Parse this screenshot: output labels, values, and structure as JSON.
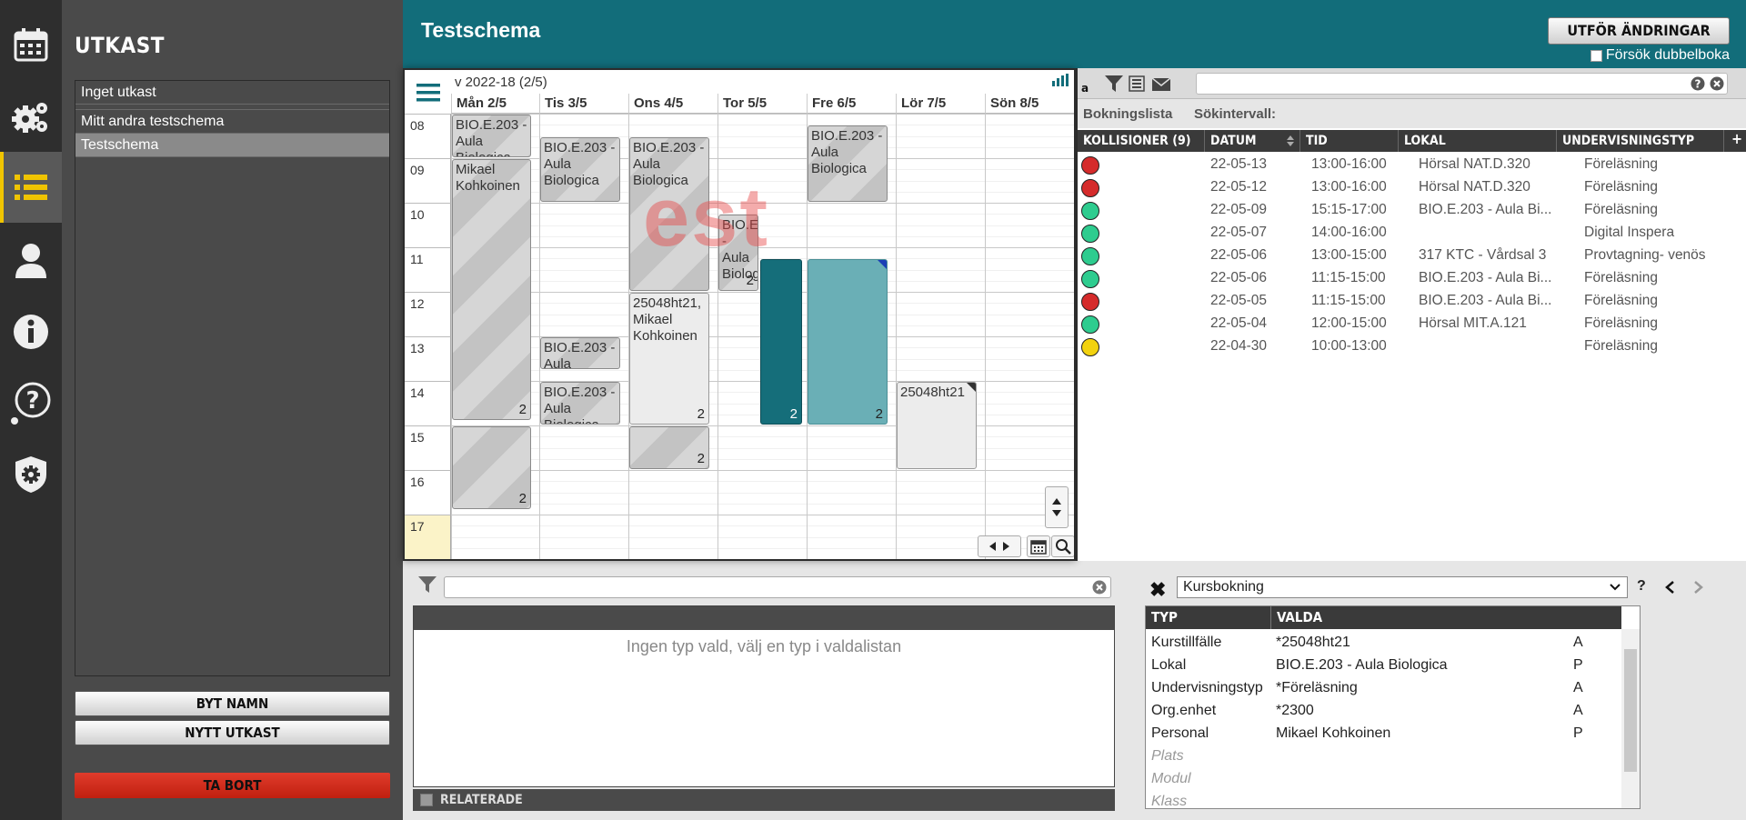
{
  "app": {
    "title": "Testschema",
    "apply_button": "UTFÖR ÄNDRINGAR",
    "double_booking_label": "Försök dubbelboka"
  },
  "nav_icons": [
    "calendar-icon",
    "settings-gears-icon",
    "list-icon",
    "user-icon",
    "info-icon",
    "help-icon",
    "admin-shield-icon"
  ],
  "drafts": {
    "heading": "UTKAST",
    "items": [
      {
        "label": "Inget utkast",
        "selected": false
      },
      {
        "label": "Mitt andra testschema",
        "selected": false
      },
      {
        "label": "Testschema",
        "selected": true
      }
    ],
    "rename_button": "BYT NAMN",
    "new_button": "NYTT UTKAST",
    "delete_button": "TA BORT"
  },
  "calendar": {
    "week_label": "v 2022-18 (2/5)",
    "days": [
      "Mån 2/5",
      "Tis 3/5",
      "Ons 4/5",
      "Tor 5/5",
      "Fre 6/5",
      "Lör 7/5",
      "Sön 8/5"
    ],
    "hours": [
      "08",
      "09",
      "10",
      "11",
      "12",
      "13",
      "14",
      "15",
      "16",
      "17"
    ],
    "current_hour": "17",
    "watermark": "est",
    "events": [
      {
        "day": 0,
        "start": 8.0,
        "end": 9.0,
        "text": "BIO.E.203 - Aula Biologica",
        "count": "",
        "style": "striped"
      },
      {
        "day": 0,
        "start": 9.0,
        "end": 14.9,
        "text": "Mikael Kohkoinen",
        "count": "2",
        "style": "striped"
      },
      {
        "day": 0,
        "start": 15.0,
        "end": 16.9,
        "text": "",
        "count": "2",
        "style": "striped"
      },
      {
        "day": 1,
        "start": 8.5,
        "end": 10.0,
        "text": "BIO.E.203 - Aula Biologica",
        "count": "",
        "style": "striped"
      },
      {
        "day": 1,
        "start": 13.0,
        "end": 13.75,
        "text": "BIO.E.203 - Aula Biologica",
        "count": "",
        "style": "striped"
      },
      {
        "day": 1,
        "start": 14.0,
        "end": 15.0,
        "text": "BIO.E.203 - Aula Biologica",
        "count": "",
        "style": "striped"
      },
      {
        "day": 2,
        "start": 8.5,
        "end": 12.0,
        "text": "BIO.E.203 - Aula Biologica",
        "count": "",
        "style": "striped"
      },
      {
        "day": 2,
        "start": 12.0,
        "end": 15.0,
        "text": "25048ht21, Mikael Kohkoinen",
        "count": "2",
        "style": "plain"
      },
      {
        "day": 2,
        "start": 15.0,
        "end": 16.0,
        "text": "",
        "count": "2",
        "style": "striped"
      },
      {
        "day": 3,
        "start": 10.25,
        "end": 12.0,
        "text": "BIO.E.203 - Aula Biologica",
        "count": "2",
        "style": "striped",
        "half": "left"
      },
      {
        "day": 3,
        "start": 11.25,
        "end": 15.0,
        "text": "",
        "count": "2",
        "style": "teal",
        "half": "right"
      },
      {
        "day": 4,
        "start": 8.25,
        "end": 10.0,
        "text": "BIO.E.203 - Aula Biologica",
        "count": "",
        "style": "striped"
      },
      {
        "day": 4,
        "start": 11.25,
        "end": 15.0,
        "text": "",
        "count": "2",
        "style": "lteal",
        "corner": "blue"
      },
      {
        "day": 5,
        "start": 14.0,
        "end": 16.0,
        "text": "25048ht21",
        "count": "",
        "style": "plain",
        "corner": "dark"
      }
    ]
  },
  "booking_list": {
    "tabs": [
      "Bokningslista",
      "Sökintervall:"
    ],
    "columns": [
      "KOLLISIONER (9)",
      "DATUM",
      "TID",
      "LOKAL",
      "UNDERVISNINGSTYP"
    ],
    "rows": [
      {
        "status": "red",
        "date": "22-05-13",
        "time": "13:00-16:00",
        "room": "Hörsal NAT.D.320",
        "type": "Föreläsning"
      },
      {
        "status": "red",
        "date": "22-05-12",
        "time": "13:00-16:00",
        "room": "Hörsal NAT.D.320",
        "type": "Föreläsning"
      },
      {
        "status": "green",
        "date": "22-05-09",
        "time": "15:15-17:00",
        "room": "BIO.E.203 - Aula Bi...",
        "type": "Föreläsning"
      },
      {
        "status": "green",
        "date": "22-05-07",
        "time": "14:00-16:00",
        "room": "",
        "type": "Digital Inspera"
      },
      {
        "status": "green",
        "date": "22-05-06",
        "time": "13:00-15:00",
        "room": "317 KTC - Vårdsal 3",
        "type": "Provtagning- venös"
      },
      {
        "status": "green",
        "date": "22-05-06",
        "time": "11:15-15:00",
        "room": "BIO.E.203 - Aula Bi...",
        "type": "Föreläsning"
      },
      {
        "status": "red",
        "date": "22-05-05",
        "time": "11:15-15:00",
        "room": "BIO.E.203 - Aula Bi...",
        "type": "Föreläsning"
      },
      {
        "status": "green",
        "date": "22-05-04",
        "time": "12:00-15:00",
        "room": "Hörsal MIT.A.121",
        "type": "Föreläsning"
      },
      {
        "status": "yellow",
        "date": "22-04-30",
        "time": "10:00-13:00",
        "room": "",
        "type": "Föreläsning"
      }
    ]
  },
  "status_colors": {
    "red": "#d52b2b",
    "green": "#2ecc8f",
    "yellow": "#f2d20f"
  },
  "selection_panel": {
    "empty_message": "Ingen typ vald, välj en typ i valdalistan",
    "related_label": "RELATERADE"
  },
  "object_panel": {
    "selected_type": "Kursbokning",
    "help": "?",
    "columns": [
      "TYP",
      "VALDA"
    ],
    "rows": [
      {
        "type": "Kurstillfälle",
        "value": "*25048ht21",
        "flag": "A"
      },
      {
        "type": "Lokal",
        "value": "BIO.E.203 - Aula Biologica",
        "flag": "P"
      },
      {
        "type": "Undervisningstyp",
        "value": "*Föreläsning",
        "flag": "A"
      },
      {
        "type": "Org.enhet",
        "value": "*2300",
        "flag": "A"
      },
      {
        "type": "Personal",
        "value": "Mikael Kohkoinen",
        "flag": "P"
      },
      {
        "type": "Plats",
        "value": "",
        "flag": ""
      },
      {
        "type": "Modul",
        "value": "",
        "flag": ""
      },
      {
        "type": "Klass",
        "value": "",
        "flag": ""
      }
    ]
  }
}
